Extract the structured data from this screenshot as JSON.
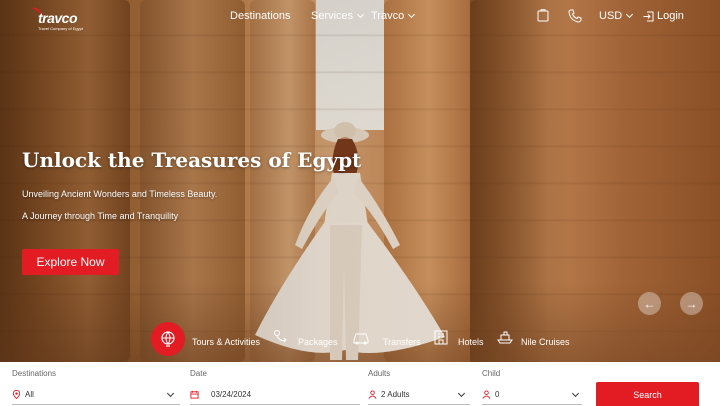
{
  "brand": {
    "name": "travco",
    "tagline": "Travel Company of Egypt",
    "accent": "#e31b23"
  },
  "nav": {
    "destinations": "Destinations",
    "services": "Services",
    "travco": "Travco",
    "currency": "USD",
    "login": "Login"
  },
  "hero": {
    "title": "Unlock the Treasures of Egypt",
    "subtitle_1": "Unveiling Ancient Wonders and Timeless Beauty.",
    "subtitle_2": "A Journey through Time and Tranquility",
    "cta": "Explore Now",
    "prev_arrow": "←",
    "next_arrow": "→"
  },
  "categories": [
    {
      "label": "Tours & Activities",
      "icon": "tours-icon",
      "active": true
    },
    {
      "label": "Packages",
      "icon": "packages-icon",
      "active": false
    },
    {
      "label": "Transfers",
      "icon": "car-icon",
      "active": false
    },
    {
      "label": "Hotels",
      "icon": "hotel-icon",
      "active": false
    },
    {
      "label": "Nile Cruises",
      "icon": "cruise-icon",
      "active": false
    }
  ],
  "search": {
    "destinations_label": "Destinations",
    "destinations_value": "All",
    "date_label": "Date",
    "date_value": "03/24/2024",
    "adults_label": "Adults",
    "adults_value": "2 Adults",
    "child_label": "Child",
    "child_value": "0",
    "button": "Search"
  }
}
